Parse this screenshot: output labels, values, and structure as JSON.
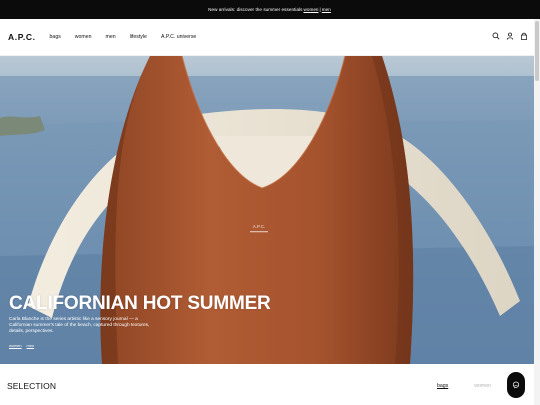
{
  "announcement": {
    "text": "New arrivals: discover the summer essentials",
    "link_women": "women",
    "separator": "|",
    "link_men": "men"
  },
  "header": {
    "logo": "A.P.C.",
    "menu": [
      "bags",
      "women",
      "men",
      "lifestyle",
      "A.P.C. universe"
    ],
    "icons": [
      "search-icon",
      "account-icon",
      "bag-icon"
    ]
  },
  "hero": {
    "title": "CALIFORNIAN HOT SUMMER",
    "description": "Carla Blanche is the series artistic like a sensory journal — a Californian summer's tale of the beach, captured through textures, details, perspectives.",
    "links": [
      "women",
      "men"
    ],
    "bag_stamp": "A.P.C.",
    "colors": {
      "leather": "#a5532e",
      "sea": "#6f8fb0",
      "sky": "#c9d5de"
    }
  },
  "selection": {
    "title": "SELECTION",
    "tabs": [
      "bags",
      "women"
    ],
    "active_tab": "bags"
  },
  "chat": {
    "icon": "chat-icon"
  }
}
